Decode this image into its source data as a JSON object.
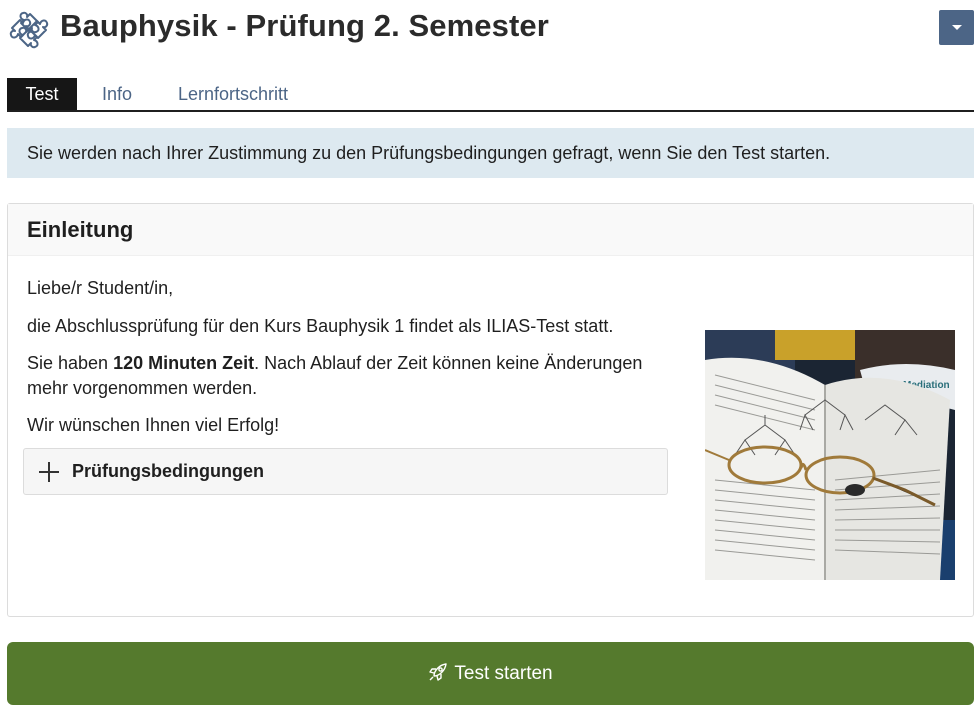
{
  "header": {
    "title": "Bauphysik - Prüfung 2. Semester",
    "title_icon": "puzzle-icon",
    "actions_icon": "caret-down-icon"
  },
  "tabs": [
    {
      "label": "Test",
      "active": true
    },
    {
      "label": "Info",
      "active": false
    },
    {
      "label": "Lernfortschritt",
      "active": false
    }
  ],
  "info_message": "Sie werden nach Ihrer Zustimmung zu den Prüfungsbedingungen gefragt, wenn Sie den Test starten.",
  "intro": {
    "heading": "Einleitung",
    "greeting": "Liebe/r Student/in,",
    "line1": "die Abschlussprüfung für den Kurs Bauphysik 1 findet als ILIAS-Test statt.",
    "line2_prefix": "Sie haben ",
    "line2_bold": "120 Minuten Zeit",
    "line2_suffix": ". Nach Ablauf der Zeit können keine Änderungen mehr vorgenommen werden.",
    "line3": "Wir wünschen Ihnen viel Erfolg!",
    "accordion_label": "Prüfungsbedingungen",
    "accordion_icon": "plus-icon",
    "image_label": "Mediation"
  },
  "start_button": {
    "label": "Test starten",
    "icon": "rocket-icon"
  },
  "colors": {
    "accent": "#4c6586",
    "tab_active_bg": "#161616",
    "info_bg": "#dde9f0",
    "start_button_bg": "#557a2d"
  }
}
